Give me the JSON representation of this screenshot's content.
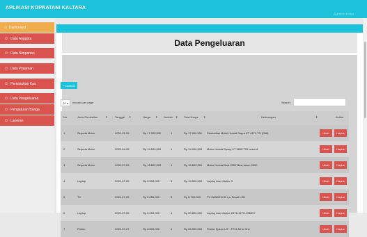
{
  "header": {
    "brand": "APLIKASI KOPRATANI KALTARA",
    "user": "Administrator"
  },
  "sidebar": {
    "items": [
      {
        "label": "Dashboard",
        "icon": "home-icon"
      },
      {
        "label": "Data Anggota",
        "icon": "users-icon"
      },
      {
        "label": "Data Simpanan",
        "icon": "users-icon"
      },
      {
        "label": "Data Pinjaman",
        "icon": "users-icon"
      },
      {
        "label": "Pemasukan Kas",
        "icon": "users-icon"
      },
      {
        "label": "Data Pengeluaran",
        "icon": "users-icon"
      },
      {
        "label": "Pengaturan Bunga",
        "icon": "users-icon"
      },
      {
        "label": "Laporan",
        "icon": "users-icon"
      }
    ],
    "active_index": 0
  },
  "main": {
    "title": "Data Pengeluaran",
    "add_button": "+ Tambah",
    "length_value": "10",
    "length_label": "records per page",
    "search_label": "Search:",
    "search_value": "",
    "columns": [
      "No",
      "Jenis Pembelian",
      "Tanggal",
      "Harga",
      "Jumlah",
      "Total Harga",
      "Keterangan",
      "Action"
    ],
    "rows": [
      [
        "1",
        "Sepeda Motor",
        "2020-01-09",
        "Rp 17.000,000",
        "1",
        "Rp 17.000,000",
        "Pembelian Motor Honda Supra KT 4474 TO (Oli8)"
      ],
      [
        "2",
        "Sepeda Motor",
        "2020-04-05",
        "Rp 14.000,000",
        "1",
        "Rp 14.000,000",
        "Motor Honda Spacy KT 4845 TGI bcscnd"
      ],
      [
        "3",
        "Sepeda Motor",
        "2020-07-03",
        "Rp 16.602,000",
        "1",
        "Rp 16.602,000",
        "Motor Honda Beat CDD New tahun 2020"
      ],
      [
        "4",
        "Laptop",
        "2020-07-05",
        "Rp 5.300,000",
        "3",
        "Rp 15.900,000",
        "Laptop Acer Aspire 3"
      ],
      [
        "5",
        "TV",
        "2020-07-05",
        "Rp 2.050,000",
        "3",
        "Rp 5.700,000",
        "TV SANKEN 32 inc Smart LED"
      ],
      [
        "6",
        "Laptop",
        "2020-07-05",
        "Rp 5.200,000",
        "4",
        "Rp 20.800,000",
        "Laptop Acer Aspire Z476-31TD-096957"
      ],
      [
        "7",
        "Printer",
        "2020-07-07",
        "Rp 6.500,000",
        "4",
        "Rp 26.000,000",
        "Printer Epson L/F - T711 All In One"
      ]
    ],
    "edit_label": "Ubah",
    "delete_label": "Hapus"
  },
  "colors": {
    "accent": "#1cc2d9",
    "danger": "#d9534f",
    "active": "#f0ad4e"
  }
}
